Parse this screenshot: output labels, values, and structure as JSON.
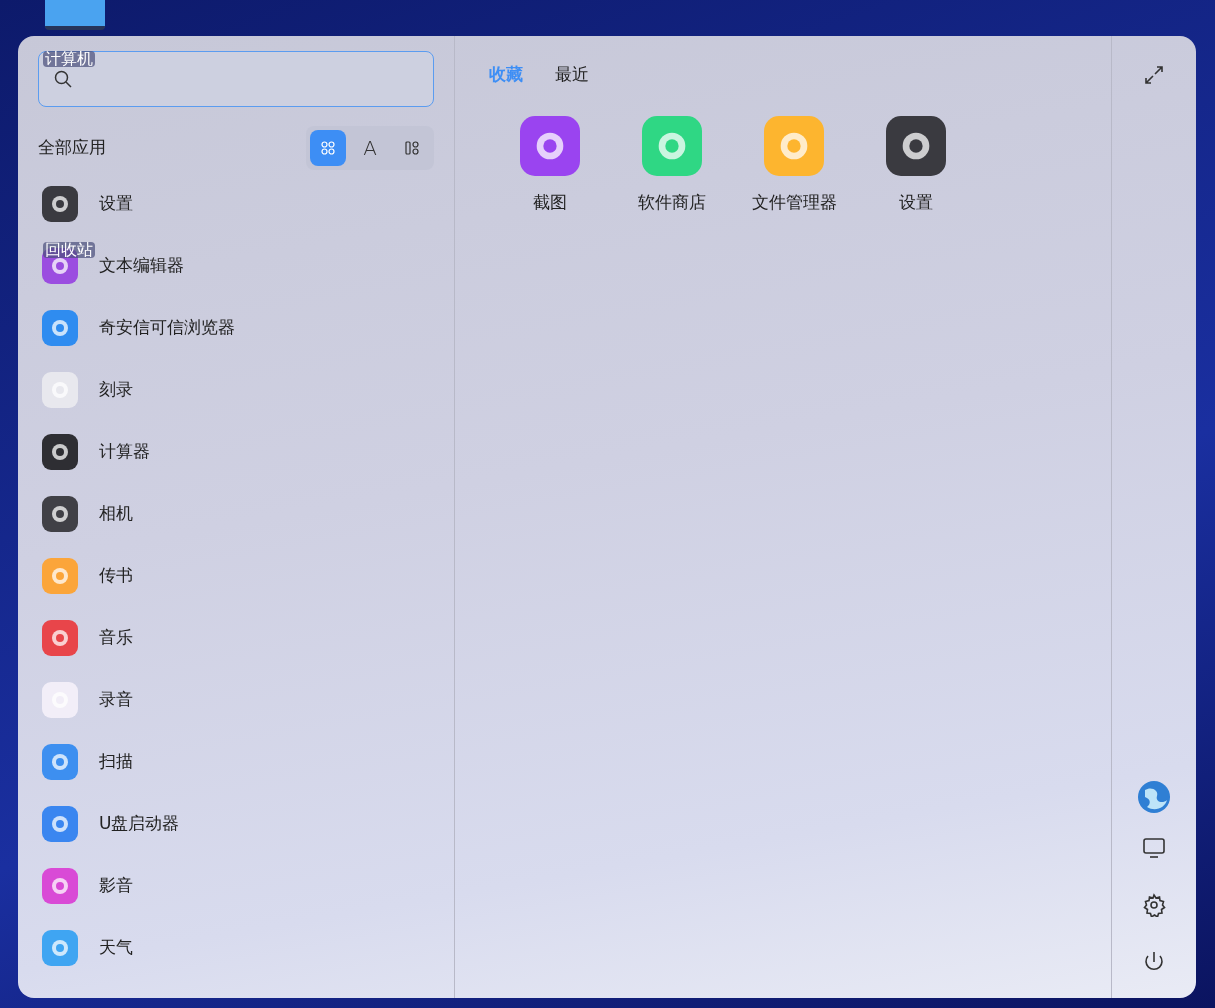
{
  "desktop_icons": [
    {
      "label": "计算机"
    },
    {
      "label": "回收站"
    }
  ],
  "all_apps": {
    "title": "全部应用",
    "view_modes": [
      {
        "kind": "grid",
        "selected": true
      },
      {
        "kind": "letter",
        "label": "A",
        "selected": false
      },
      {
        "kind": "category",
        "selected": false
      }
    ],
    "items": [
      {
        "name": "设置",
        "color": "#3a3a40"
      },
      {
        "name": "文本编辑器",
        "color": "#9b4de0"
      },
      {
        "name": "奇安信可信浏览器",
        "color": "#2f8cf0"
      },
      {
        "name": "刻录",
        "color": "#e8e8ee"
      },
      {
        "name": "计算器",
        "color": "#2e2e33"
      },
      {
        "name": "相机",
        "color": "#404046"
      },
      {
        "name": "传书",
        "color": "#fba53a"
      },
      {
        "name": "音乐",
        "color": "#e8454a"
      },
      {
        "name": "录音",
        "color": "#f2eef8"
      },
      {
        "name": "扫描",
        "color": "#3d8ff0"
      },
      {
        "name": "U盘启动器",
        "color": "#3a86f0"
      },
      {
        "name": "影音",
        "color": "#d94ad6"
      },
      {
        "name": "天气",
        "color": "#3fa5f2"
      }
    ]
  },
  "tabs": [
    {
      "label": "收藏",
      "selected": true
    },
    {
      "label": "最近",
      "selected": false
    }
  ],
  "favorites": [
    {
      "name": "截图",
      "color": "#9a44f0"
    },
    {
      "name": "软件商店",
      "color": "#2fd784"
    },
    {
      "name": "文件管理器",
      "color": "#fdb52f"
    },
    {
      "name": "设置",
      "color": "#3a3a40"
    }
  ]
}
